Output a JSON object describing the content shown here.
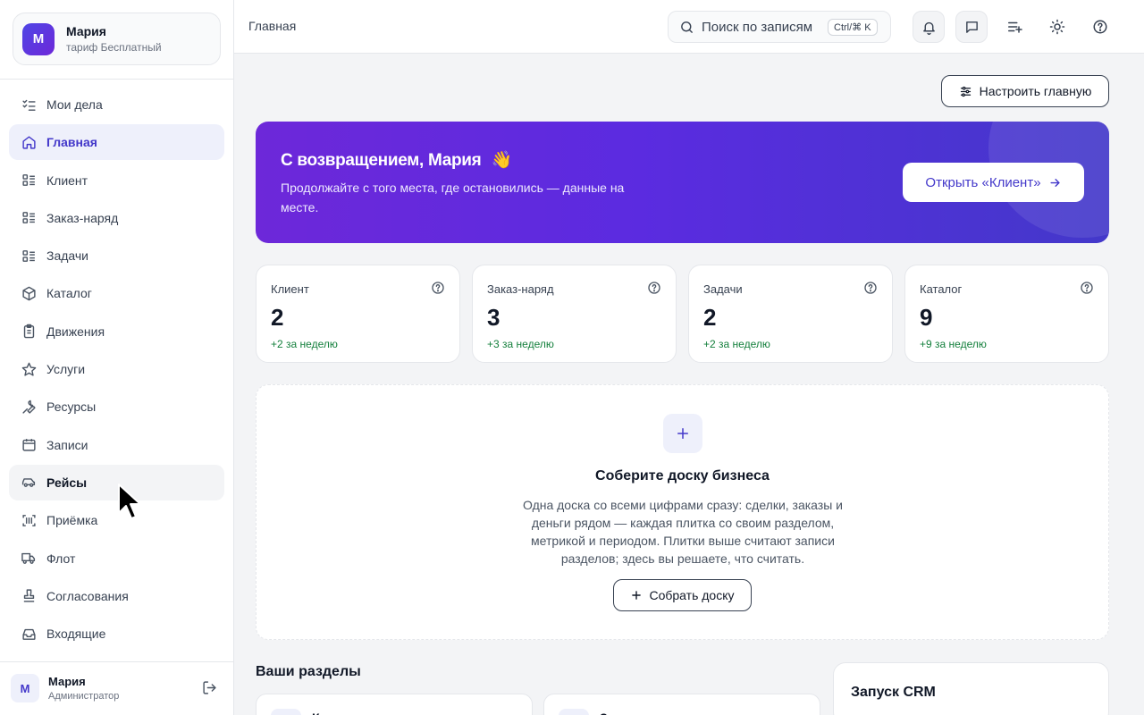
{
  "account": {
    "avatar_letter": "М",
    "name": "Мария",
    "plan": "тариф Бесплатный"
  },
  "sidebar": {
    "items": [
      {
        "label": "Мои дела",
        "icon": "checklist-icon"
      },
      {
        "label": "Главная",
        "icon": "home-icon",
        "state": "active"
      },
      {
        "label": "Клиент",
        "icon": "list-icon"
      },
      {
        "label": "Заказ-наряд",
        "icon": "list-icon"
      },
      {
        "label": "Задачи",
        "icon": "list-icon"
      },
      {
        "label": "Каталог",
        "icon": "box-icon"
      },
      {
        "label": "Движения",
        "icon": "clipboard-icon"
      },
      {
        "label": "Услуги",
        "icon": "star-icon"
      },
      {
        "label": "Ресурсы",
        "icon": "wrench-icon"
      },
      {
        "label": "Записи",
        "icon": "calendar-icon"
      },
      {
        "label": "Рейсы",
        "icon": "car-icon",
        "state": "hover"
      },
      {
        "label": "Приёмка",
        "icon": "scan-icon"
      },
      {
        "label": "Флот",
        "icon": "truck-icon"
      },
      {
        "label": "Согласования",
        "icon": "stamp-icon"
      },
      {
        "label": "Входящие",
        "icon": "inbox-icon"
      }
    ]
  },
  "user": {
    "avatar_letter": "М",
    "name": "Мария",
    "role": "Администратор"
  },
  "topbar": {
    "breadcrumb": "Главная",
    "search_placeholder": "Поиск по записям",
    "search_shortcut": "Ctrl/⌘ K"
  },
  "main": {
    "customize_label": "Настроить главную",
    "hero": {
      "title": "С возвращением, Мария",
      "emoji": "👋",
      "subtitle": "Продолжайте с того места, где остановились — данные на месте.",
      "button_label": "Открыть «Клиент»"
    },
    "stats": [
      {
        "label": "Клиент",
        "value": "2",
        "delta": "+2 за неделю"
      },
      {
        "label": "Заказ-наряд",
        "value": "3",
        "delta": "+3 за неделю"
      },
      {
        "label": "Задачи",
        "value": "2",
        "delta": "+2 за неделю"
      },
      {
        "label": "Каталог",
        "value": "9",
        "delta": "+9 за неделю"
      }
    ],
    "board": {
      "title": "Соберите доску бизнеса",
      "text": "Одна доска со всеми цифрами сразу: сделки, заказы и деньги рядом — каждая плитка со своим разделом, метрикой и периодом. Плитки выше считают записи разделов; здесь вы решаете, что считать.",
      "button_label": "Собрать доску"
    },
    "sections_title": "Ваши разделы",
    "section_cards": [
      {
        "label": "К"
      },
      {
        "label": "З"
      }
    ],
    "crm_title": "Запуск CRM"
  },
  "colors": {
    "accent": "#4338ca",
    "hero_start": "#6d28d9",
    "positive": "#15803d"
  }
}
